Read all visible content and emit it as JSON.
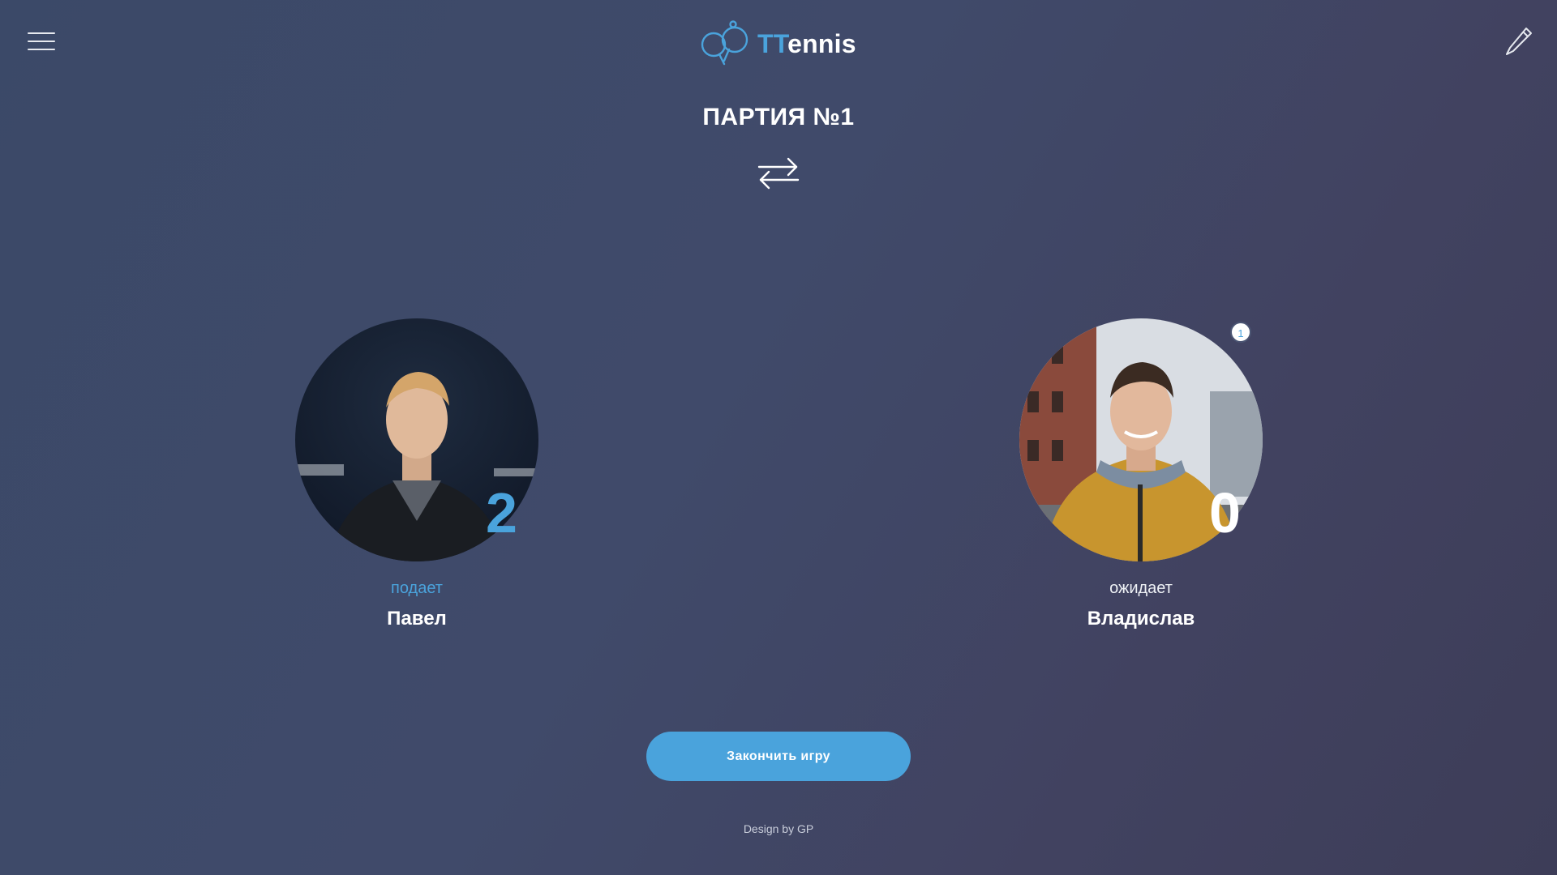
{
  "app": {
    "title_accent": "TT",
    "title_rest": "ennis"
  },
  "game": {
    "title": "ПАРТИЯ №1"
  },
  "players": [
    {
      "name": "Павел",
      "score": "2",
      "status": "подает",
      "serving": true
    },
    {
      "name": "Владислав",
      "score": "0",
      "status": "ожидает",
      "serving": false,
      "badge": "1"
    }
  ],
  "actions": {
    "finish_label": "Закончить игру"
  },
  "footer": {
    "text": "Design by GP"
  },
  "colors": {
    "accent": "#4aa3dc",
    "background": "#404a6a",
    "text": "#ffffff"
  },
  "icons": {
    "menu": "hamburger-menu-icon",
    "edit": "pencil-icon",
    "swap": "swap-arrows-icon",
    "logo": "ping-pong-paddles-icon"
  }
}
